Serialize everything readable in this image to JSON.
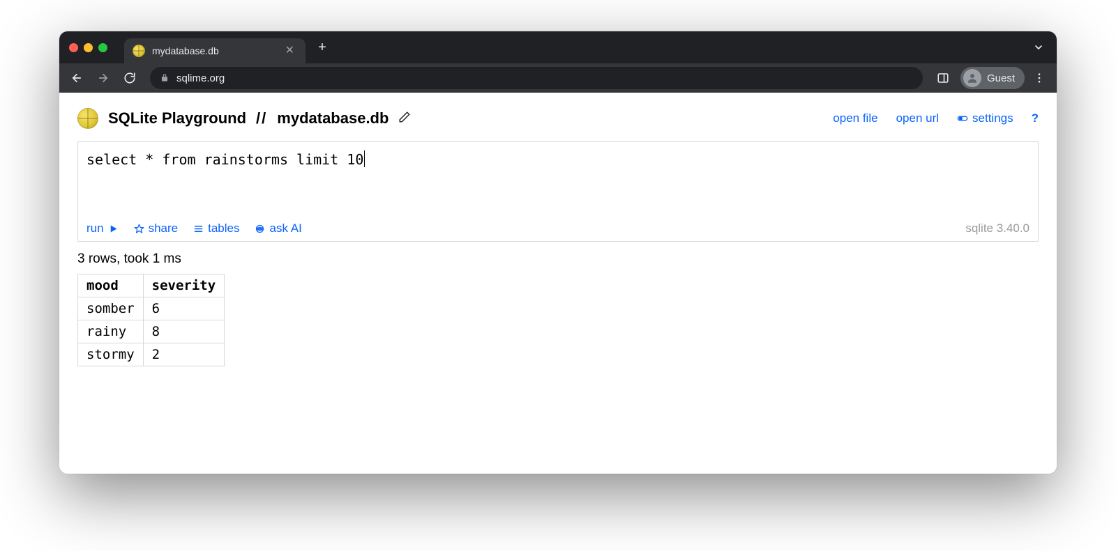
{
  "browser": {
    "tab_title": "mydatabase.db",
    "url": "sqlime.org",
    "guest_label": "Guest"
  },
  "header": {
    "app_title": "SQLite Playground",
    "separator": "//",
    "db_name": "mydatabase.db",
    "links": {
      "open_file": "open file",
      "open_url": "open url",
      "settings": "settings",
      "help": "?"
    }
  },
  "editor": {
    "query": "select * from rainstorms limit 10",
    "toolbar": {
      "run": "run",
      "share": "share",
      "tables": "tables",
      "ask_ai": "ask AI"
    },
    "version_label": "sqlite 3.40.0"
  },
  "results": {
    "status": "3 rows, took 1 ms",
    "columns": [
      "mood",
      "severity"
    ],
    "rows": [
      {
        "mood": "somber",
        "severity": "6"
      },
      {
        "mood": "rainy",
        "severity": "8"
      },
      {
        "mood": "stormy",
        "severity": "2"
      }
    ]
  }
}
